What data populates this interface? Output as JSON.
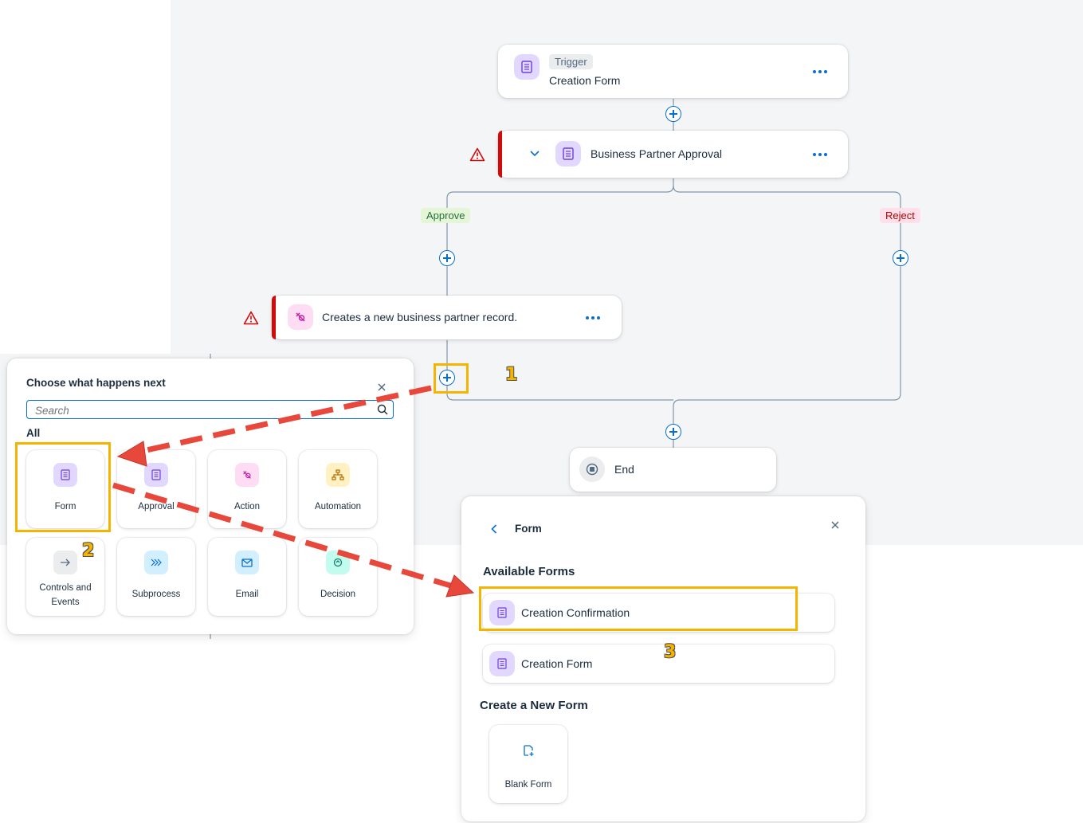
{
  "flow": {
    "trigger": {
      "tag": "Trigger",
      "name": "Creation Form"
    },
    "approval": {
      "name": "Business Partner Approval"
    },
    "branches": {
      "approve": "Approve",
      "reject": "Reject"
    },
    "action": {
      "name": "Creates a new business partner record."
    },
    "end": {
      "label": "End"
    }
  },
  "chooser": {
    "title": "Choose what happens next",
    "search_placeholder": "Search",
    "section": "All",
    "tiles": [
      {
        "label": "Form",
        "icon": "form-icon"
      },
      {
        "label": "Approval",
        "icon": "approval-icon"
      },
      {
        "label": "Action",
        "icon": "action-icon"
      },
      {
        "label": "Automation",
        "icon": "automation-icon"
      },
      {
        "label": "Controls and Events",
        "icon": "arrow-right-icon"
      },
      {
        "label": "Subprocess",
        "icon": "subprocess-icon"
      },
      {
        "label": "Email",
        "icon": "email-icon"
      },
      {
        "label": "Decision",
        "icon": "decision-icon"
      }
    ]
  },
  "form_panel": {
    "title": "Form",
    "available_heading": "Available Forms",
    "forms": [
      "Creation Confirmation",
      "Creation Form"
    ],
    "create_heading": "Create a New Form",
    "blank_form": "Blank Form"
  },
  "annotations": {
    "step1": "1",
    "step2": "2",
    "step3": "3"
  },
  "colors": {
    "accent": "#0a6ed1",
    "highlight": "#f5b400",
    "arrow": "#e8473c",
    "error": "#d20a0a"
  }
}
